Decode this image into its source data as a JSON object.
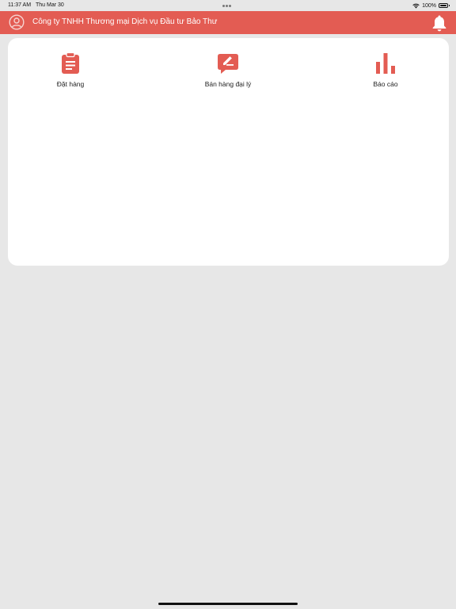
{
  "status_bar": {
    "time": "11:37 AM",
    "date": "Thu Mar 30",
    "battery": "100%"
  },
  "header": {
    "title": "Công ty TNHH Thương mại Dịch vụ Đầu tư Bảo Thư",
    "avatar_icon": "user-circle-icon",
    "notification_icon": "bell-icon"
  },
  "menu": {
    "items": [
      {
        "label": "Đặt hàng",
        "icon": "clipboard-icon"
      },
      {
        "label": "Bán hàng đại lý",
        "icon": "edit-message-icon"
      },
      {
        "label": "Báo cáo",
        "icon": "bar-chart-icon"
      }
    ]
  },
  "colors": {
    "accent": "#e35c53",
    "background": "#e7e7e7",
    "card": "#ffffff"
  }
}
